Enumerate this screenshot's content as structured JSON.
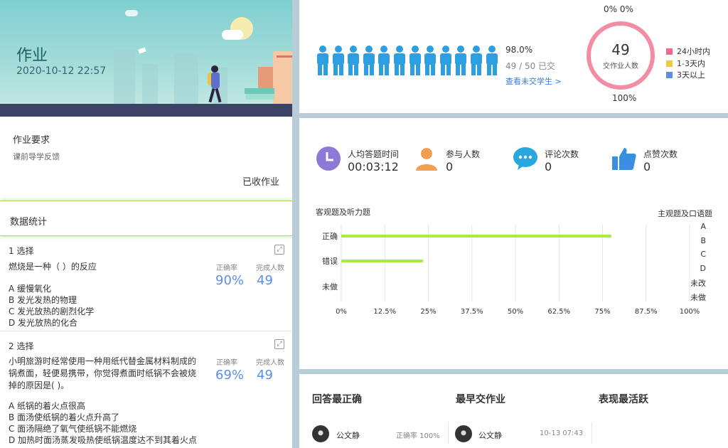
{
  "homework": {
    "title": "作业",
    "datetime": "2020-10-12 22:57",
    "requirement_title": "作业要求",
    "requirement_text": "课前导学反馈",
    "received_label": "已收作业",
    "stats_title": "数据统计"
  },
  "questions": [
    {
      "number": "1 选择",
      "stem": "燃烧是一种（ ）的反应",
      "options": [
        "A 缓慢氧化",
        "B 发光发热的物理",
        "C 发光放热的剧烈化学",
        "D 发光放热的化合"
      ],
      "accuracy_label": "正确率",
      "accuracy": "90%",
      "completed_label": "完成人数",
      "completed": "49"
    },
    {
      "number": "2 选择",
      "stem": "小明旅游时经常使用一种用纸代替金属材料制成的锅煮面，轻便易携带，你觉得煮面时纸锅不会被烧掉的原因是( )。",
      "options": [
        "A 纸锅的着火点很高",
        "B 面汤使纸锅的着火点升高了",
        "C 面汤隔绝了氧气使纸锅不能燃烧",
        "D 加热时面汤蒸发吸热使纸锅温度达不到其着火点"
      ],
      "accuracy_label": "正确率",
      "accuracy": "69%",
      "completed_label": "完成人数",
      "completed": "49"
    }
  ],
  "submission": {
    "figure_count": 12,
    "rate": "98.0%",
    "count_text": "49 / 50 已交",
    "link_text": "查看未交学生 >",
    "top_zeros": "0%  0%",
    "ring_value": "49",
    "ring_label": "交作业人数",
    "bottom_pct": "100%",
    "legend": [
      {
        "label": "24小时内",
        "color": "#f06b8f"
      },
      {
        "label": "1-3天内",
        "color": "#f5c842"
      },
      {
        "label": "3天以上",
        "color": "#5b8fe6"
      }
    ]
  },
  "kpis": [
    {
      "label": "人均答题时间",
      "value": "00:03:12",
      "icon": "clock-icon",
      "color": "#8e7ad6"
    },
    {
      "label": "参与人数",
      "value": "0",
      "icon": "person-icon",
      "color": "#f0a050"
    },
    {
      "label": "评论次数",
      "value": "0",
      "icon": "chat-icon",
      "color": "#29a8e0"
    },
    {
      "label": "点赞次数",
      "value": "0",
      "icon": "thumbs-up-icon",
      "color": "#3a8fe0"
    }
  ],
  "chart_data": {
    "type": "bar",
    "orientation": "horizontal",
    "title": "客观题及听力题",
    "categories": [
      "正确",
      "错误",
      "未做"
    ],
    "values": [
      0.775,
      0.235,
      0
    ],
    "xlim": [
      0,
      1
    ],
    "xticks": [
      "0%",
      "12.5%",
      "25%",
      "37.5%",
      "50%",
      "62.5%",
      "75%",
      "87.5%",
      "100%"
    ],
    "color": "#a6ee3c",
    "grid": true
  },
  "subjective": {
    "title": "主观题及口语题",
    "items": [
      "A",
      "B",
      "C",
      "D",
      "未改",
      "未做"
    ]
  },
  "leaderboard": [
    {
      "title": "回答最正确",
      "name": "公文静",
      "meta": "正确率 100%"
    },
    {
      "title": "最早交作业",
      "name": "公文静",
      "meta": "10-13 07:43"
    },
    {
      "title": "表现最活跃",
      "name": "",
      "meta": ""
    }
  ]
}
